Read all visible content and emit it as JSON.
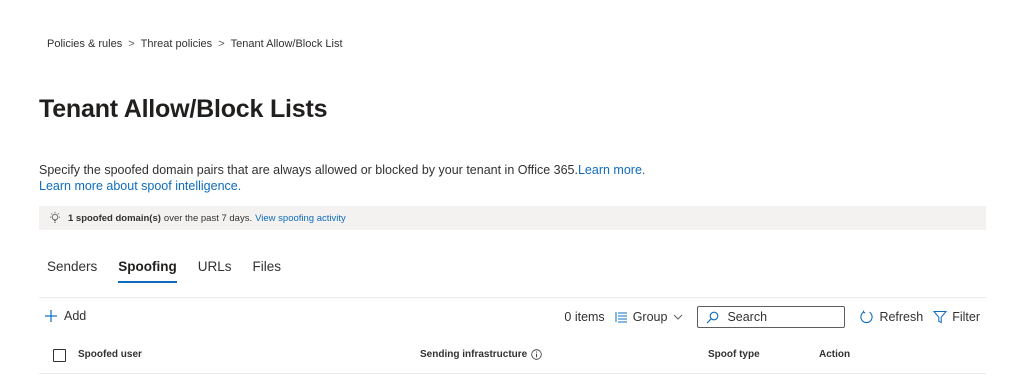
{
  "breadcrumb": {
    "items": [
      "Policies & rules",
      "Threat policies",
      "Tenant Allow/Block List"
    ],
    "separator": ">"
  },
  "page": {
    "title": "Tenant Allow/Block Lists",
    "description": "Specify the spoofed domain pairs that are always allowed or blocked by your tenant in Office 365.",
    "learn_more": "Learn more.",
    "learn_more_spoof": "Learn more about spoof intelligence."
  },
  "infobar": {
    "icon": "lightbulb-icon",
    "bold_text": "1 spoofed domain(s)",
    "text": "over the past 7 days.",
    "link": "View spoofing activity"
  },
  "tabs": [
    {
      "label": "Senders",
      "active": false
    },
    {
      "label": "Spoofing",
      "active": true
    },
    {
      "label": "URLs",
      "active": false
    },
    {
      "label": "Files",
      "active": false
    }
  ],
  "toolbar": {
    "add_label": "Add",
    "item_count": "0 items",
    "group_label": "Group",
    "search_placeholder": "Search",
    "refresh_label": "Refresh",
    "filter_label": "Filter"
  },
  "table": {
    "columns": [
      "Spoofed user",
      "Sending infrastructure",
      "Spoof type",
      "Action"
    ]
  },
  "colors": {
    "accent": "#0f6cbd",
    "infobar_bg": "#f3f2f1",
    "text": "#323130"
  }
}
